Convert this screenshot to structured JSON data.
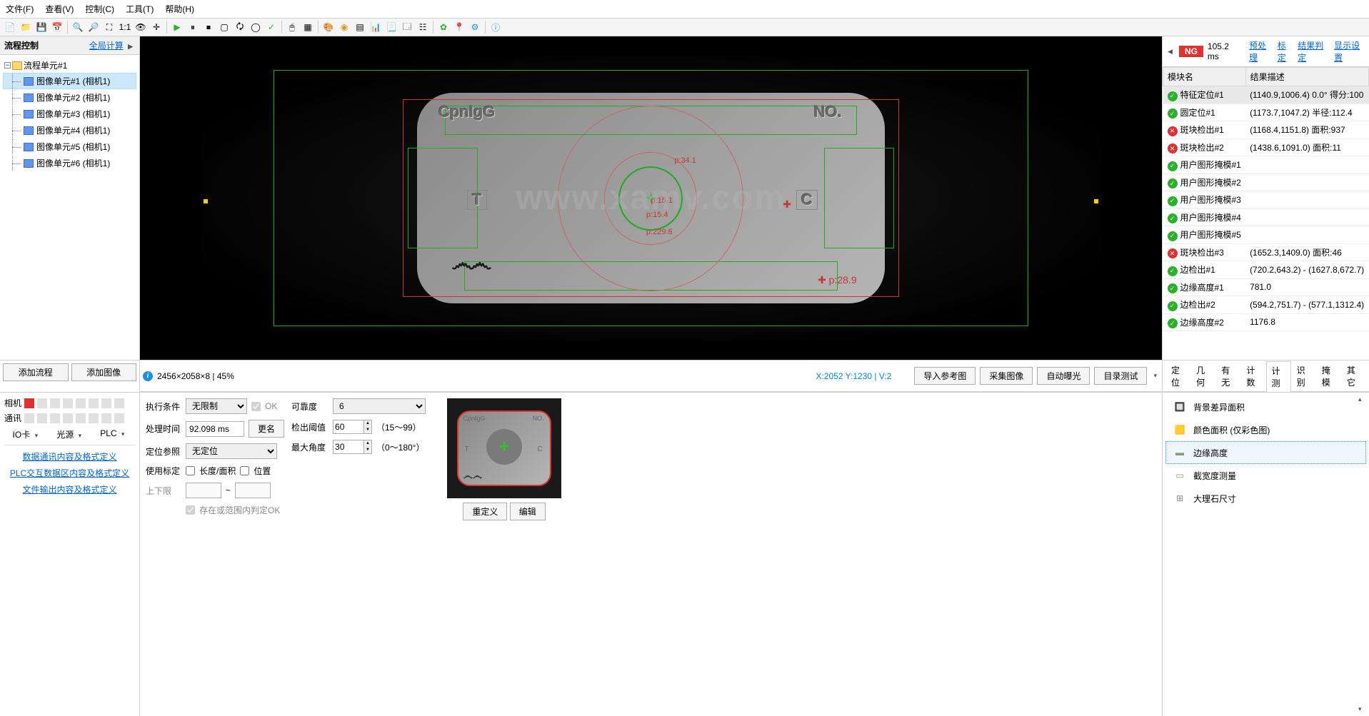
{
  "menu": [
    "文件(F)",
    "查看(V)",
    "控制(C)",
    "工具(T)",
    "帮助(H)"
  ],
  "left": {
    "title": "流程控制",
    "link": "全局计算",
    "root": "流程单元#1",
    "items": [
      "图像单元#1 (相机1)",
      "图像单元#2 (相机1)",
      "图像单元#3 (相机1)",
      "图像单元#4 (相机1)",
      "图像单元#5 (相机1)",
      "图像单元#6 (相机1)"
    ],
    "addFlow": "添加流程",
    "addImage": "添加图像"
  },
  "status": {
    "info": "2456×2058×8 | 45%",
    "coord": "X:2052 Y:1230 | V:2",
    "btns": [
      "导入参考图",
      "采集图像",
      "自动曝光",
      "目录测试"
    ]
  },
  "bl": {
    "rows": [
      "相机",
      "通讯"
    ],
    "io": [
      "IO卡",
      "光源",
      "PLC"
    ],
    "links": [
      "数据通讯内容及格式定义",
      "PLC交互数据区内容及格式定义",
      "文件输出内容及格式定义"
    ]
  },
  "form": {
    "execCond": "执行条件",
    "execVal": "无限制",
    "ok": "OK",
    "procTime": "处理时间",
    "procVal": "92.098 ms",
    "rename": "更名",
    "posRef": "定位参照",
    "posVal": "无定位",
    "useCalib": "使用标定",
    "len": "长度/面积",
    "pos": "位置",
    "limits": "上下限",
    "to": "~",
    "saveOK": "存在或范围内判定OK",
    "reliability": "可靠度",
    "relVal": "6",
    "detThresh": "检出阈值",
    "detVal": "60",
    "detRange": "（15～99）",
    "maxAngle": "最大角度",
    "angVal": "30",
    "angRange": "（0～180°）",
    "redefine": "重定义",
    "edit": "编辑"
  },
  "right": {
    "ng": "NG",
    "time": "105.2 ms",
    "links": [
      "预处理",
      "标定",
      "结果判定",
      "显示设置"
    ],
    "cols": [
      "模块名",
      "结果描述"
    ],
    "rows": [
      {
        "ok": true,
        "name": "特征定位#1",
        "desc": "(1140.9,1006.4) 0.0° 得分:100",
        "sel": true
      },
      {
        "ok": true,
        "name": "圆定位#1",
        "desc": "(1173.7,1047.2) 半径:112.4"
      },
      {
        "ok": false,
        "name": "斑块检出#1",
        "desc": "(1168.4,1151.8) 面积:937"
      },
      {
        "ok": false,
        "name": "斑块检出#2",
        "desc": "(1438.6,1091.0) 面积:11"
      },
      {
        "ok": true,
        "name": "用户图形掩模#1",
        "desc": ""
      },
      {
        "ok": true,
        "name": "用户图形掩模#2",
        "desc": ""
      },
      {
        "ok": true,
        "name": "用户图形掩模#3",
        "desc": ""
      },
      {
        "ok": true,
        "name": "用户图形掩模#4",
        "desc": ""
      },
      {
        "ok": true,
        "name": "用户图形掩模#5",
        "desc": ""
      },
      {
        "ok": false,
        "name": "斑块检出#3",
        "desc": "(1652.3,1409.0) 面积:46"
      },
      {
        "ok": true,
        "name": "边检出#1",
        "desc": "(720.2,643.2) - (1627.8,672.7)"
      },
      {
        "ok": true,
        "name": "边缘高度#1",
        "desc": "781.0"
      },
      {
        "ok": true,
        "name": "边检出#2",
        "desc": "(594.2,751.7) - (577.1,1312.4)"
      },
      {
        "ok": true,
        "name": "边缘高度#2",
        "desc": "1176.8"
      }
    ],
    "tabs": [
      "定位",
      "几何",
      "有无",
      "计数",
      "计测",
      "识别",
      "掩模",
      "其它"
    ],
    "measures": [
      "背景差异面积",
      "颜色面积 (仅彩色图)",
      "边缘高度",
      "截宽度测量",
      "大理石尺寸"
    ]
  },
  "plate": {
    "title": "CpnIgG",
    "no": "NO.",
    "t": "T",
    "c": "C"
  },
  "wm": "www.xamv.com"
}
